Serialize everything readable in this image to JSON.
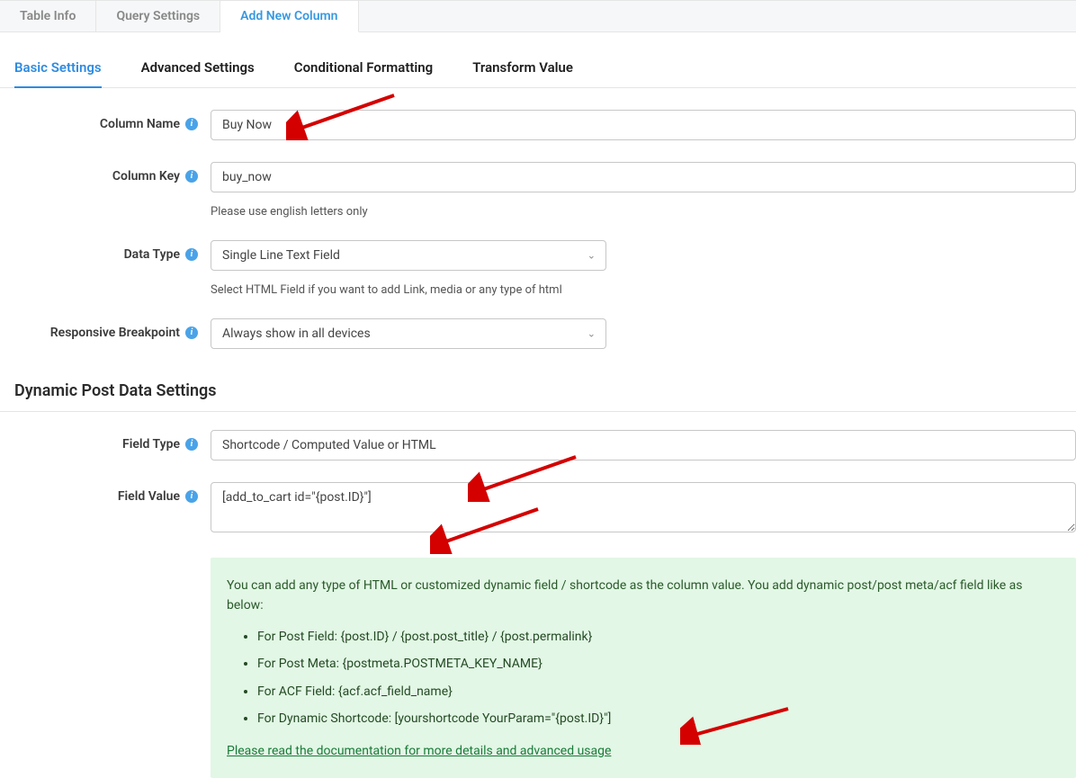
{
  "topTabs": {
    "tableInfo": "Table Info",
    "querySettings": "Query Settings",
    "addNewColumn": "Add New Column"
  },
  "subTabs": {
    "basic": "Basic Settings",
    "advanced": "Advanced Settings",
    "conditional": "Conditional Formatting",
    "transform": "Transform Value"
  },
  "labels": {
    "columnName": "Column Name",
    "columnKey": "Column Key",
    "dataType": "Data Type",
    "responsiveBreakpoint": "Responsive Breakpoint",
    "fieldType": "Field Type",
    "fieldValue": "Field Value"
  },
  "values": {
    "columnName": "Buy Now",
    "columnKey": "buy_now",
    "dataType": "Single Line Text Field",
    "responsiveBreakpoint": "Always show in all devices",
    "fieldType": "Shortcode / Computed Value or HTML",
    "fieldValue": "[add_to_cart id=\"{post.ID}\"]"
  },
  "helpers": {
    "columnKey": "Please use english letters only",
    "dataType": "Select HTML Field if you want to add Link, media or any type of html"
  },
  "sectionTitle": "Dynamic Post Data Settings",
  "hint": {
    "intro": "You can add any type of HTML or customized dynamic field / shortcode as the column value. You add dynamic post/post meta/acf field like as below:",
    "items": [
      "For Post Field: {post.ID} / {post.post_title} / {post.permalink}",
      "For Post Meta: {postmeta.POSTMETA_KEY_NAME}",
      "For ACF Field: {acf.acf_field_name}",
      "For Dynamic Shortcode: [yourshortcode YourParam=\"{post.ID}\"]"
    ],
    "link": "Please read the documentation for more details and advanced usage"
  }
}
